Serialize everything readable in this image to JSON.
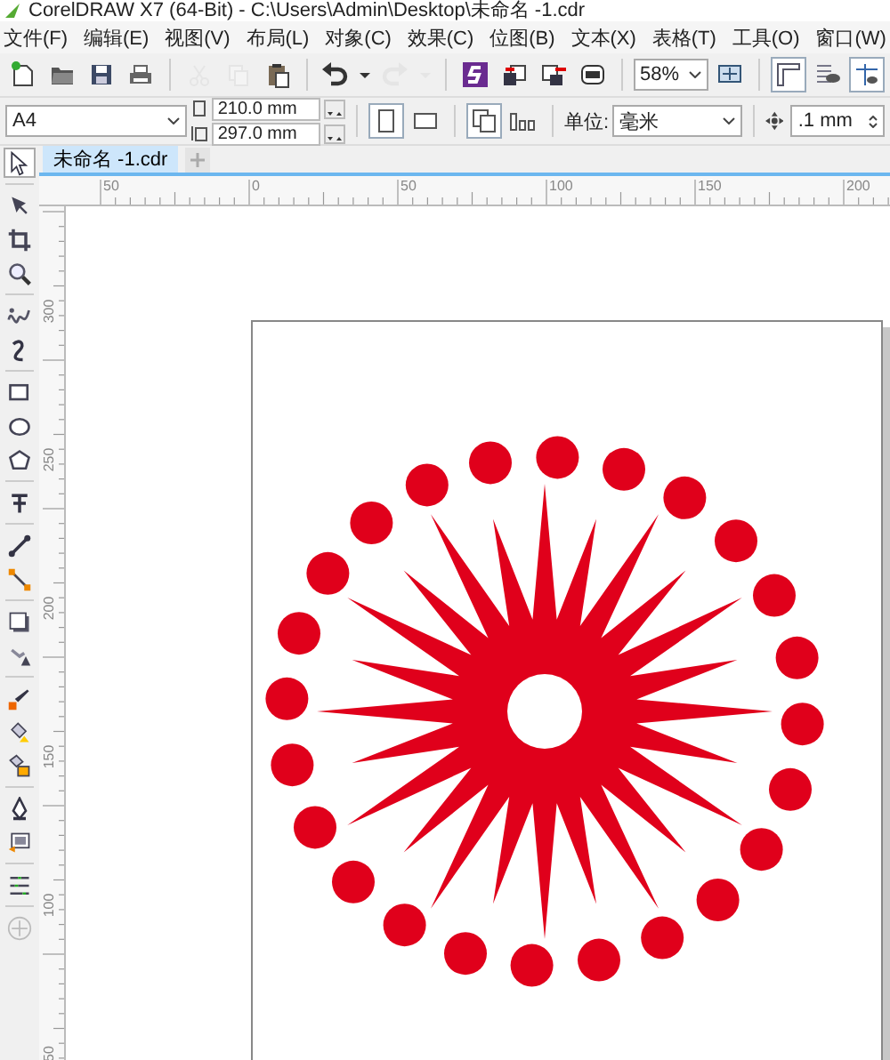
{
  "window": {
    "title": "CorelDRAW X7 (64-Bit) - C:\\Users\\Admin\\Desktop\\未命名 -1.cdr"
  },
  "menu": [
    "文件(F)",
    "编辑(E)",
    "视图(V)",
    "布局(L)",
    "对象(C)",
    "效果(C)",
    "位图(B)",
    "文本(X)",
    "表格(T)",
    "工具(O)",
    "窗口(W)"
  ],
  "toolbar": [
    {
      "kind": "new",
      "disabled": false
    },
    {
      "kind": "open",
      "disabled": false
    },
    {
      "kind": "save",
      "disabled": false
    },
    {
      "kind": "print",
      "disabled": false
    },
    {
      "kind": "cut",
      "disabled": true
    },
    {
      "kind": "copy",
      "disabled": true
    },
    {
      "kind": "paste",
      "disabled": false
    },
    {
      "kind": "undo",
      "disabled": false
    },
    {
      "kind": "undo-menu",
      "disabled": false
    },
    {
      "kind": "redo",
      "disabled": true
    },
    {
      "kind": "redo-menu",
      "disabled": true
    },
    {
      "kind": "connect",
      "disabled": false
    },
    {
      "kind": "import",
      "disabled": false
    },
    {
      "kind": "export",
      "disabled": false
    },
    {
      "kind": "pdf",
      "disabled": false
    }
  ],
  "zoom": {
    "value": "58%"
  },
  "view_toggles": [
    {
      "kind": "rulers",
      "on": true
    },
    {
      "kind": "grid",
      "on": false
    },
    {
      "kind": "guidelines",
      "on": true
    }
  ],
  "property_bar": {
    "page_size": "A4",
    "width": "210.0 mm",
    "height": "297.0 mm",
    "units_label": "单位:",
    "units": "毫米",
    "nudge": ".1 mm"
  },
  "orientation": [
    {
      "kind": "portrait",
      "selected": true
    },
    {
      "kind": "landscape",
      "selected": false
    }
  ],
  "tabs": [
    {
      "label": "未命名 -1.cdr",
      "selected": true
    }
  ],
  "rulers": {
    "horizontal": [
      "50",
      "0",
      "50",
      "100",
      "150",
      "200"
    ],
    "vertical": [
      "300",
      "250",
      "200",
      "150",
      "100",
      "50"
    ]
  }
}
